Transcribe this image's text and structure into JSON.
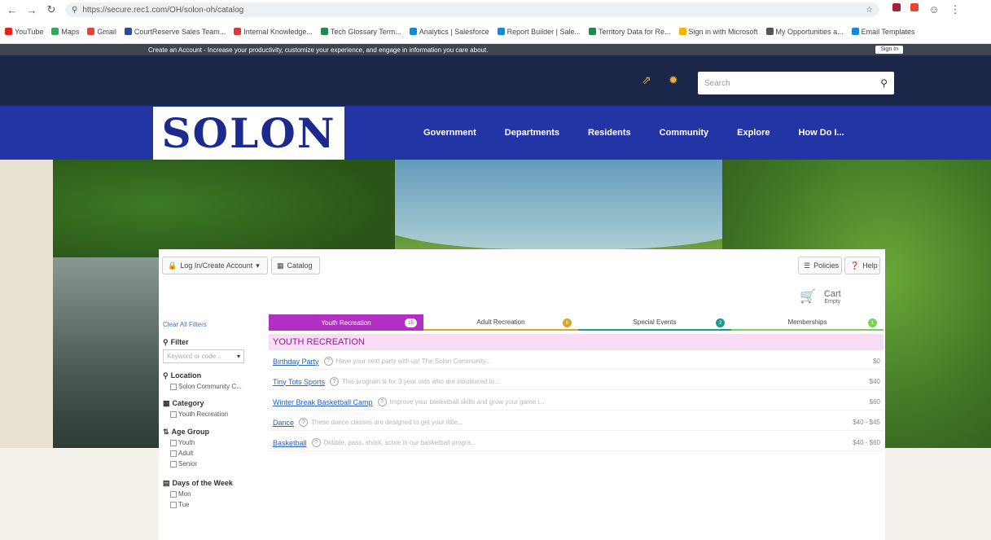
{
  "browser": {
    "url": "https://secure.rec1.com/OH/solon-oh/catalog",
    "bookmarks": [
      "YouTube",
      "Maps",
      "Gmail",
      "CourtReserve Sales Team...",
      "Internal Knowledge...",
      "Tech Glossary Term...",
      "Analytics | Salesforce",
      "Report Builder | Sale...",
      "Territory Data for Re...",
      "Sign in with Microsoft",
      "My Opportunities a...",
      "Email Templates"
    ]
  },
  "promo": {
    "text": "Create an Account - Increase your productivity, customize your experience, and engage in information you care about.",
    "sign_in": "Sign In"
  },
  "header": {
    "search_placeholder": "Search",
    "logo_text": "SOLON",
    "nav": [
      "Government",
      "Departments",
      "Residents",
      "Community",
      "Explore",
      "How Do I..."
    ]
  },
  "toolbar": {
    "login": "Log In/Create Account",
    "catalog": "Catalog",
    "policies": "Policies",
    "help": "Help",
    "cart": "Cart",
    "cart_sub": "Empty"
  },
  "sidebar": {
    "clear": "Clear All Filters",
    "filter": "Filter",
    "keyword_placeholder": "Keyword or code...",
    "location": "Location",
    "location_option": "Solon Community C...",
    "category": "Category",
    "category_option": "Youth Recreation",
    "age_group": "Age Group",
    "age_options": [
      "Youth",
      "Adult",
      "Senior"
    ],
    "days": "Days of the Week",
    "day_options": [
      "Mon",
      "Tue"
    ]
  },
  "tabs": [
    {
      "label": "Youth Recreation",
      "badge": "15",
      "color": "#b22fc4"
    },
    {
      "label": "Adult Recreation",
      "badge": "6",
      "color": "#d4a72c"
    },
    {
      "label": "Special Events",
      "badge": "2",
      "color": "#1a9c8c"
    },
    {
      "label": "Memberships",
      "badge": "1",
      "color": "#7ccf5a"
    }
  ],
  "results": {
    "heading": "YOUTH RECREATION",
    "items": [
      {
        "title": "Birthday Party",
        "desc": "Have your next party with us! The Solon Community...",
        "price": "$0"
      },
      {
        "title": "Tiny Tots Sports",
        "desc": "This program is for 3 year olds who are introduced to...",
        "price": "$40"
      },
      {
        "title": "Winter Break Basketball Camp",
        "desc": "Improve your basketball skills and grow your game i...",
        "price": "$60"
      },
      {
        "title": "Dance",
        "desc": "These dance classes are designed to get your little...",
        "price": "$40 - $45"
      },
      {
        "title": "Basketball",
        "desc": "Dribble, pass, shoot, score in our basketball progra...",
        "price": "$40 - $60"
      }
    ]
  }
}
